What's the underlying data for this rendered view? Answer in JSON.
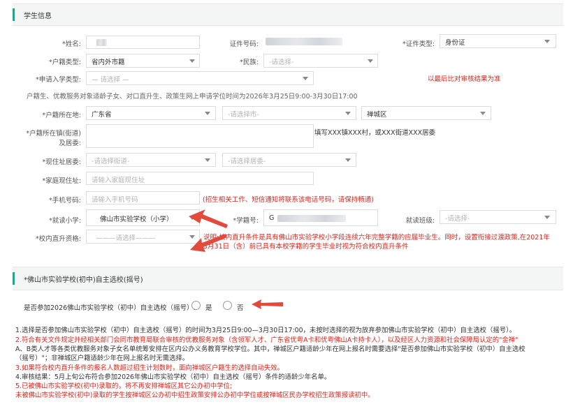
{
  "section1": {
    "title": "学生信息"
  },
  "fields": {
    "name": {
      "label": "*姓名:"
    },
    "id_number": {
      "label": "证件号码:"
    },
    "id_type": {
      "label": "*证件类型:",
      "value": "身份证"
    },
    "hukou_type": {
      "label": "*户籍类型:",
      "value": "省内外市籍"
    },
    "ethnicity": {
      "label": "*民族:",
      "placeholder": "-请选择-"
    },
    "apply_type": {
      "label": "*申请入学类型:",
      "placeholder": "— 请选择 —",
      "note": "以最后比对审核结果为准"
    },
    "time_note": "户籍生、优教服务对象适龄子女、对口直升生、政策生网上申请学位时间为2026年3月25日9:00-3月30日17:00",
    "hukou_location": {
      "label": "*户籍所在地:",
      "province": "广东省",
      "city_placeholder": "-请选择市-",
      "district": "禅城区"
    },
    "hukou_town": {
      "label_line1": "*户籍所在镇(街道)",
      "label_line2": "及居委:",
      "hint": "填写XXX镇XXX村，或XXX街道XXX居委"
    },
    "residence": {
      "label": "*现住址居委:",
      "street_placeholder": "-请选择街道-",
      "committee_placeholder": "-请选择居委-"
    },
    "home_address": {
      "label": "*家庭现住址:",
      "placeholder": "请输入家庭现住址"
    },
    "phone": {
      "label": "*手机号码:",
      "placeholder": "请输入手机号码",
      "note": "(招生相关工作、短信通知将联系该电话号码，请保持畅通)"
    },
    "primary_school": {
      "label": "*就读小学:",
      "value": "佛山市实验学校（小学）"
    },
    "student_no": {
      "label": "*学籍号:",
      "value": "G"
    },
    "grade_class": {
      "label": "就读班级:",
      "placeholder": "-请选择-"
    },
    "direct_promotion": {
      "label": "*校内直升资格:",
      "placeholder": "———请选择———",
      "note_line1": "说明:校内直升条件是具有佛山市实验学校小学段连续六年完整学籍的应届毕业生。同时，设置衔接过渡政策,在2021年",
      "note_line2": "3月31日（含）前已具有本校学籍的学生毕业时视为符合校内直升条件"
    }
  },
  "section2": {
    "title": "*佛山市实验学校(初中)自主选校(摇号)"
  },
  "lottery": {
    "question": "是否参加2026佛山市实验学校（初中）自主选校（摇号）:",
    "yes": "是",
    "no": "否"
  },
  "notes": [
    {
      "text": "1.选择是否参加佛山市实验学校（初中）自主选校（摇号）的时间为3月25日9:00—3月30日17:00，未按时选择的视为放弃参加佛山市实验学校（初中）自主选校（摇号）。",
      "color": "#333333"
    },
    {
      "text": "2.符合有关文件规定并经相关部门会同市教育局联合审核的优教服务对象（含领军人才、广东省优粤A卡和优粤佛山A卡持卡人），以及经区人力资源和社会保障局认定的\"金禅\"",
      "color": "#e2231a"
    },
    {
      "text": "A、B类人才等各类优教服务对象子女名单统筹安排在区内公办义务教育学校学位。其中，禅城区户籍适龄少年在网上报名时需要选择\"是否参加佛山市实验学校（初中）自主选校",
      "color": "#333333"
    },
    {
      "text": "（摇号）\"；非禅城区户籍适龄少年在网上报名时无需选择。",
      "color": "#333333"
    },
    {
      "text": "3.如果符合校内直升条件的报名人数超过招生计划数时，面向禅城区户籍生的选择自动失效。",
      "color": "#e2231a"
    },
    {
      "text": "4.审核结果：5月上旬公布符合参加2026年佛山市实验学校（初中）自主选校（摇号）条件的适龄少年名单。",
      "color": "#333333"
    },
    {
      "text": "5.已被佛山市实验学校(初中)录取的，将不再安排禅城区其它公办初中学位;",
      "color": "#e2231a"
    },
    {
      "text": "未被佛山市实验学校(初中)录取的学生按禅城区公办初中招生政策安排公办初中学位或按禅城区民办学校招生政策报读初中。",
      "color": "#e2231a"
    }
  ],
  "colors": {
    "accent": "#2aa18c",
    "warning": "#e2231a",
    "arrow": "#e24a3c"
  }
}
